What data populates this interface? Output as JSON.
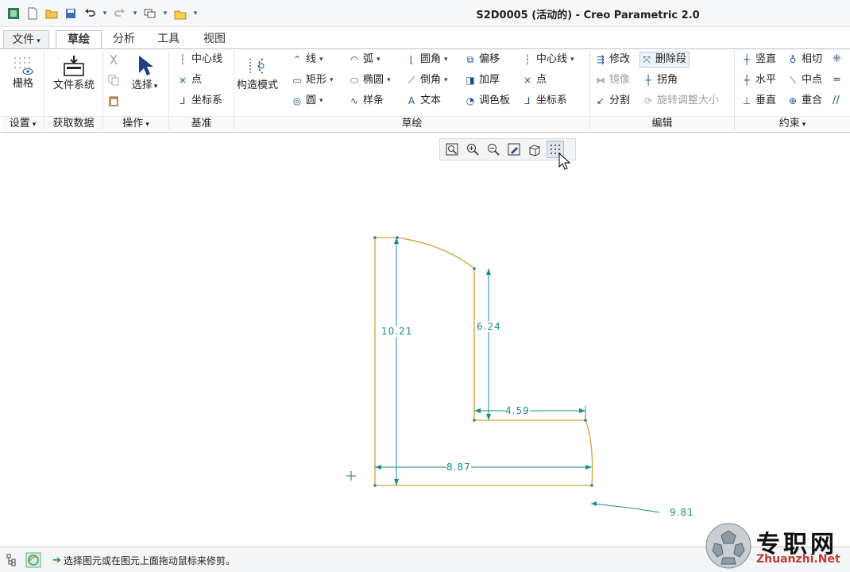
{
  "window": {
    "title": "S2D0005 (活动的) - Creo Parametric 2.0"
  },
  "tabs": [
    {
      "label": "文件",
      "caret": "▾"
    },
    {
      "label": "草绘"
    },
    {
      "label": "分析"
    },
    {
      "label": "工具"
    },
    {
      "label": "视图"
    }
  ],
  "ribbon": {
    "groups": [
      {
        "label": "设置",
        "caret": "▾"
      },
      {
        "label": "获取数据"
      },
      {
        "label": "操作",
        "caret": "▾"
      },
      {
        "label": "基准"
      },
      {
        "label": "草绘"
      },
      {
        "label": "编辑"
      },
      {
        "label": "约束",
        "caret": "▾"
      }
    ],
    "setup": {
      "grid": "栅格"
    },
    "getdata": {
      "filesystem": "文件系统"
    },
    "operations": {
      "select": "选择"
    },
    "datum": {
      "centerline": "中心线",
      "point": "点",
      "csys": "坐标系"
    },
    "sketch": {
      "construction": "构造模式",
      "line": "线",
      "rect": "矩形",
      "circle": "圆",
      "arc": "弧",
      "ellipse": "椭圆",
      "spline": "样条",
      "fillet": "圆角",
      "chamfer": "倒角",
      "text": "文本",
      "offset": "偏移",
      "thicken": "加厚",
      "palette": "调色板",
      "centerline": "中心线",
      "point": "点",
      "csys": "坐标系"
    },
    "edit": {
      "modify": "修改",
      "delete_segment": "删除段",
      "mirror": "镜像",
      "corner": "拐角",
      "divide": "分割",
      "rotate_resize": "旋转调整大小"
    },
    "constrain": {
      "vertical": "竖直",
      "tangent": "相切",
      "horizontal": "水平",
      "midpoint": "中点",
      "perpendicular": "垂直",
      "coincident": "重合"
    }
  },
  "dimensions": {
    "left_height": "10.21",
    "inner_height": "6.24",
    "inner_width": "4.59",
    "base_width": "8.87",
    "leader_value": "9.81"
  },
  "status": {
    "message": "选择图元或在图元上面拖动鼠标来修剪。"
  },
  "watermark": {
    "name": "专职网",
    "url": "Zhuanzhi.Net"
  },
  "colors": {
    "sketch": "#d4a23a",
    "dimension": "#1b8a8a",
    "accent": "#1c4f8a"
  }
}
